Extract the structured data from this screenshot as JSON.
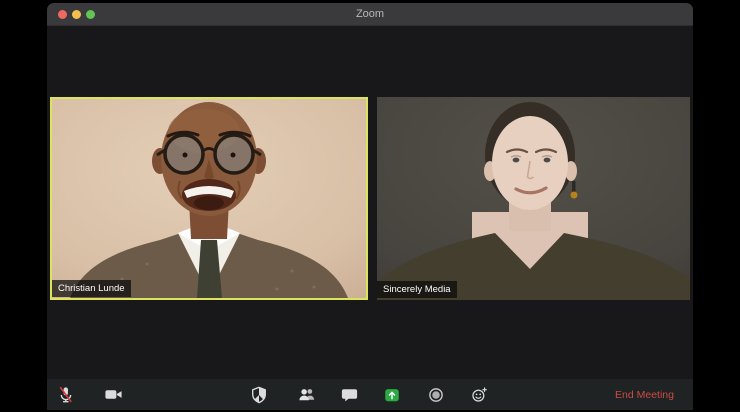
{
  "window": {
    "title": "Zoom",
    "traffic_lights": [
      {
        "name": "close",
        "color": "#ee6a5e"
      },
      {
        "name": "minimize",
        "color": "#f5bf4f"
      },
      {
        "name": "maximize",
        "color": "#61c454"
      }
    ]
  },
  "meeting": {
    "participants": [
      {
        "name": "Christian Lunde",
        "active_speaker": true
      },
      {
        "name": "Sincerely Media",
        "active_speaker": false
      }
    ],
    "active_speaker_border_color": "#dbe45c"
  },
  "toolbar": {
    "items": [
      {
        "name": "mute",
        "icon": "microphone-muted-icon",
        "state": "muted"
      },
      {
        "name": "video",
        "icon": "video-camera-icon"
      },
      {
        "name": "security",
        "icon": "security-shield-icon"
      },
      {
        "name": "participants",
        "icon": "participants-people-icon"
      },
      {
        "name": "chat",
        "icon": "chat-bubble-icon"
      },
      {
        "name": "share-screen",
        "icon": "share-screen-arrow-icon",
        "accent_color": "#2bab45"
      },
      {
        "name": "record",
        "icon": "record-circle-icon"
      },
      {
        "name": "reactions",
        "icon": "smiley-plus-icon"
      }
    ],
    "end_meeting_label": "End Meeting",
    "end_meeting_color": "#cf4a44"
  }
}
